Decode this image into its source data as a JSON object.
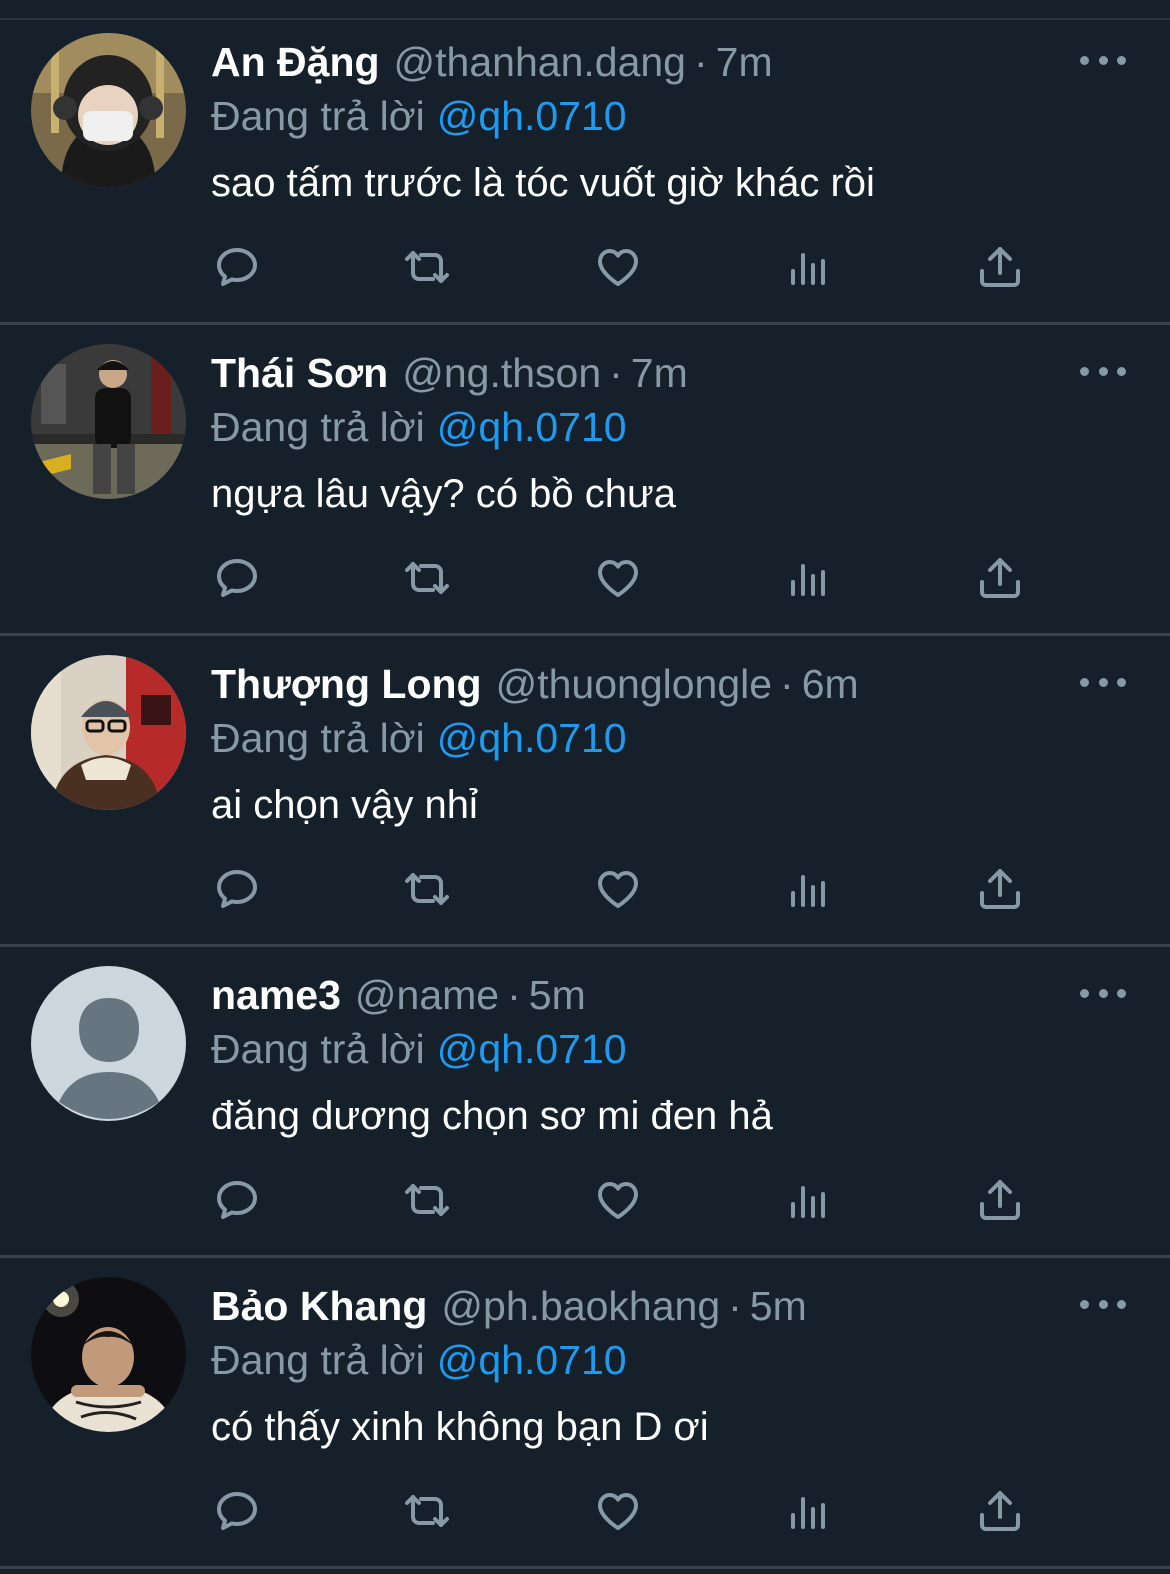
{
  "colors": {
    "background": "#15202b",
    "divider": "#38444d",
    "muted": "#8899a6",
    "link": "#1d9bf0",
    "text": "#ffffff"
  },
  "icons": [
    "more-icon",
    "reply-icon",
    "retweet-icon",
    "like-icon",
    "views-icon",
    "share-icon"
  ],
  "tweets": [
    {
      "name": "An Đặng",
      "handle": "@thanhan.dang",
      "separator": "·",
      "time": "7m",
      "reply_label": "Đang trả lời",
      "reply_to": "@qh.0710",
      "text": "sao tấm trước là tóc vuốt giờ khác rồi"
    },
    {
      "name": "Thái Sơn",
      "handle": "@ng.thson",
      "separator": "·",
      "time": "7m",
      "reply_label": "Đang trả lời",
      "reply_to": "@qh.0710",
      "text": "ngựa lâu vậy? có bồ chưa"
    },
    {
      "name": "Thượng Long",
      "handle": "@thuonglongle",
      "separator": "·",
      "time": "6m",
      "reply_label": "Đang trả lời",
      "reply_to": "@qh.0710",
      "text": "ai chọn vậy nhỉ"
    },
    {
      "name": "name3",
      "handle": "@name",
      "separator": "·",
      "time": "5m",
      "reply_label": "Đang trả lời",
      "reply_to": "@qh.0710",
      "text": "đăng dương chọn sơ mi đen hả"
    },
    {
      "name": "Bảo Khang",
      "handle": "@ph.baokhang",
      "separator": "·",
      "time": "5m",
      "reply_label": "Đang trả lời",
      "reply_to": "@qh.0710",
      "text": "có thấy xinh không bạn D ơi"
    }
  ]
}
